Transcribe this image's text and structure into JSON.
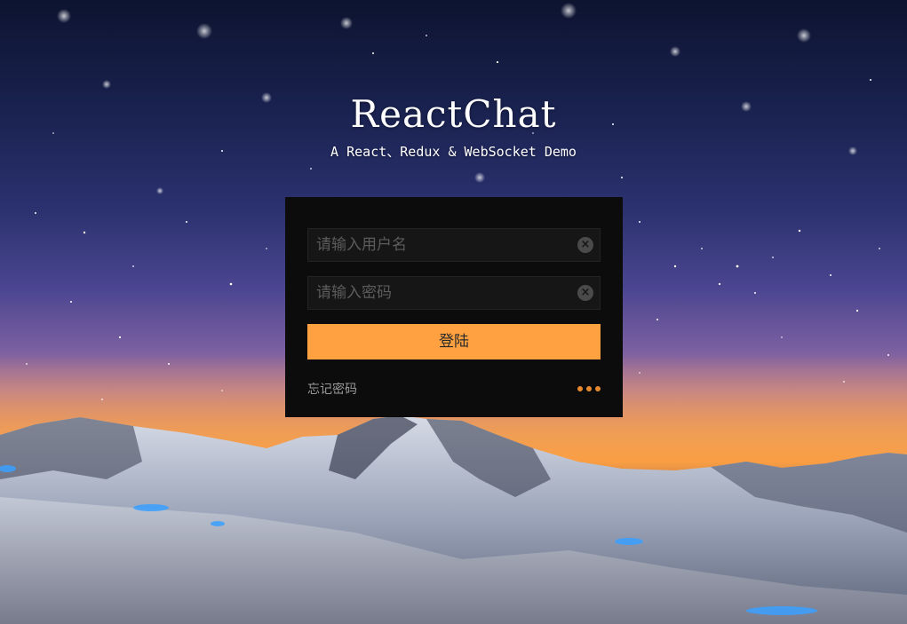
{
  "app": {
    "title": "ReactChat",
    "subtitle": "A React、Redux & WebSocket Demo"
  },
  "login": {
    "username_placeholder": "请输入用户名",
    "username_value": "",
    "password_placeholder": "请输入密码",
    "password_value": "",
    "submit_label": "登陆",
    "forgot_label": "忘记密码",
    "clear_glyph": "×"
  },
  "icons": {
    "username_clear": "clear-circle-icon",
    "password_clear": "clear-circle-icon",
    "more": "more-horizontal-icon"
  },
  "colors": {
    "accent": "#ffa141",
    "more_dots": "#e7892f",
    "card_bg": "#0c0c0c",
    "field_bg": "#161616"
  }
}
